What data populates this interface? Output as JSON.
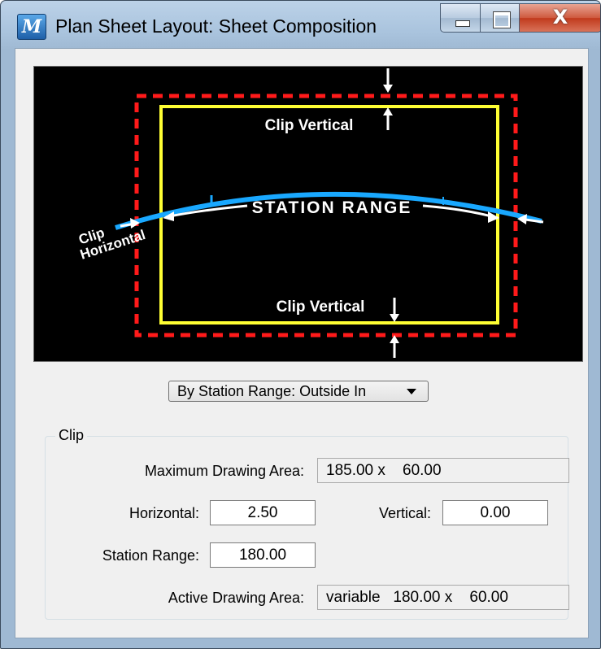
{
  "window": {
    "title": "Plan Sheet Layout: Sheet Composition",
    "icon": "microstation-app-icon",
    "buttons": {
      "minimize": "minimize-icon",
      "maximize": "maximize-icon",
      "close_label": "X"
    }
  },
  "preview": {
    "labels": {
      "clip_vertical_top": "Clip Vertical",
      "clip_vertical_bottom": "Clip Vertical",
      "station_range": "STATION RANGE",
      "clip_horizontal_line1": "Clip",
      "clip_horizontal_line2": "Horizontal"
    },
    "colors": {
      "background": "#000000",
      "sheet_border": "#ff1a1a",
      "clip_boundary": "#ffff33",
      "alignment": "#19a8ff",
      "annotation": "#ffffff"
    }
  },
  "clip_mode": {
    "selected": "By Station Range: Outside In"
  },
  "clip": {
    "group_label": "Clip",
    "max_area_label": "Maximum Drawing Area:",
    "max_area_value": "185.00 x    60.00",
    "horizontal_label": "Horizontal:",
    "horizontal_value": "2.50",
    "vertical_label": "Vertical:",
    "vertical_value": "0.00",
    "station_range_label": "Station Range:",
    "station_range_value": "180.00",
    "active_area_label": "Active Drawing Area:",
    "active_area_value": "variable   180.00 x    60.00"
  }
}
